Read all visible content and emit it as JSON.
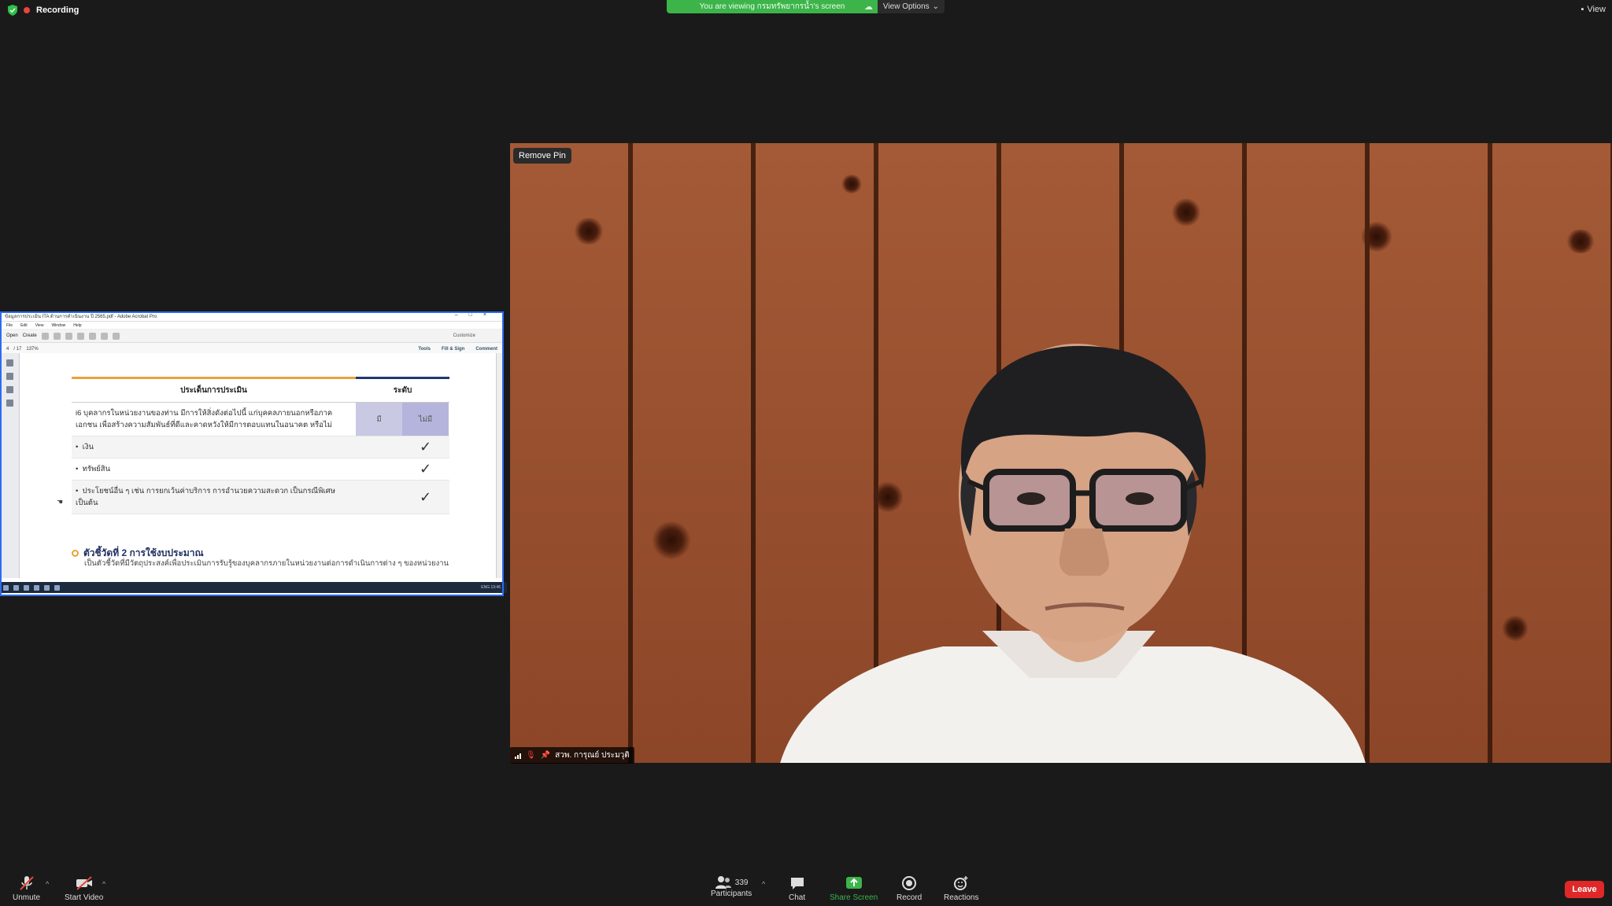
{
  "top": {
    "recording_label": "Recording",
    "viewing_banner": "You are viewing กรมทรัพยากรน้ำ's screen",
    "view_options_label": "View Options",
    "view_label": "View"
  },
  "shared_screen": {
    "window_title": "ข้อมูลการประเมิน ITA ด้านการดำเนินงาน ปี 2565.pdf - Adobe Acrobat Pro",
    "menu": [
      "File",
      "Edit",
      "View",
      "Window",
      "Help"
    ],
    "toolbar": {
      "open": "Open",
      "create": "Create",
      "customize": "Customize"
    },
    "nav": {
      "page": "4",
      "of": "/ 17",
      "zoom": "137%",
      "tools": "Tools",
      "fill_sign": "Fill & Sign",
      "comment": "Comment"
    },
    "table": {
      "col_issue": "ประเด็นการประเมิน",
      "col_level": "ระดับ",
      "question": "i6 บุคลากรในหน่วยงานของท่าน มีการให้สิ่งดังต่อไปนี้ แก่บุคคลภายนอกหรือภาคเอกชน เพื่อสร้างความสัมพันธ์ที่ดีและคาดหวังให้มีการตอบแทนในอนาคต หรือไม่",
      "yes": "มี",
      "no": "ไม่มี",
      "items": [
        "เงิน",
        "ทรัพย์สิน",
        "ประโยชน์อื่น ๆ เช่น การยกเว้นค่าบริการ การอำนวยความสะดวก เป็นกรณีพิเศษ เป็นต้น"
      ],
      "check": "✓"
    },
    "kpi_title": "ตัวชี้วัดที่ 2 การใช้งบประมาณ",
    "kpi_desc": "เป็นตัวชี้วัดที่มีวัตถุประสงค์เพื่อประเมินการรับรู้ของบุคลากรภายในหน่วยงานต่อการดำเนินการต่าง ๆ ของหน่วยงาน",
    "taskbar_tray": "ENG  13:46"
  },
  "video": {
    "remove_pin": "Remove Pin",
    "participant_name": "สวพ. การุณย์ ประมวุติ"
  },
  "controls": {
    "unmute": "Unmute",
    "start_video": "Start Video",
    "participants": "Participants",
    "participants_count": "339",
    "chat": "Chat",
    "share_screen": "Share Screen",
    "record": "Record",
    "reactions": "Reactions",
    "leave": "Leave"
  },
  "colors": {
    "share_green": "#3cb44a",
    "leave_red": "#e02828",
    "share_border": "#2d6cf0"
  }
}
